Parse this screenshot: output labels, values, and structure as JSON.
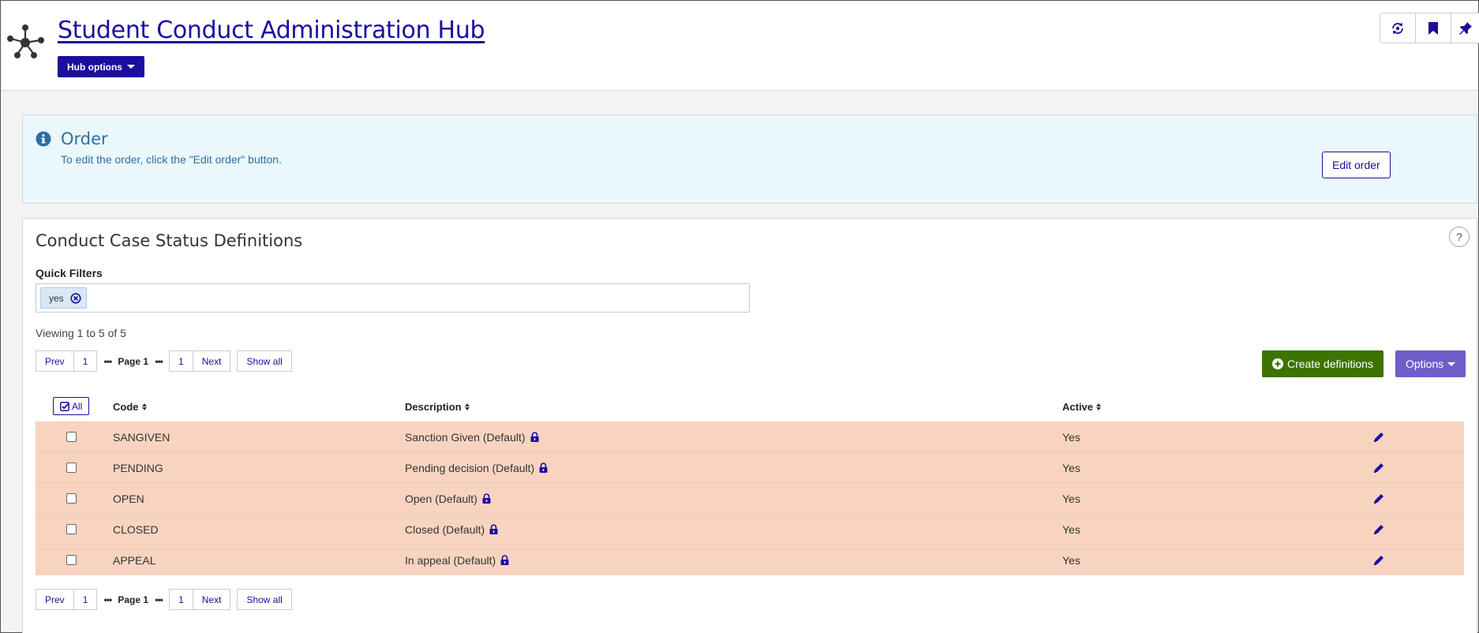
{
  "header": {
    "title": "Student Conduct Administration Hub",
    "hub_options_label": "Hub options",
    "tools": [
      "sync-icon",
      "bookmark-icon",
      "pin-icon"
    ]
  },
  "order_panel": {
    "title": "Order",
    "text": "To edit the order, click the \"Edit order\" button.",
    "edit_button": "Edit order"
  },
  "definitions": {
    "title": "Conduct Case Status Definitions",
    "help_label": "?",
    "quick_filters": {
      "label": "Quick Filters",
      "chips": [
        "yes"
      ]
    },
    "viewing_text": "Viewing 1 to 5 of 5",
    "pager": {
      "prev": "Prev",
      "first": "1",
      "dots": "•••",
      "current": "Page 1",
      "last": "1",
      "next": "Next",
      "show_all": "Show all"
    },
    "create_button": "Create definitions",
    "options_button": "Options",
    "table": {
      "select_all_label": "All",
      "columns": [
        "Code",
        "Description",
        "Active"
      ],
      "rows": [
        {
          "code": "SANGIVEN",
          "description": "Sanction Given (Default)",
          "active": "Yes"
        },
        {
          "code": "PENDING",
          "description": "Pending decision (Default)",
          "active": "Yes"
        },
        {
          "code": "OPEN",
          "description": "Open (Default)",
          "active": "Yes"
        },
        {
          "code": "CLOSED",
          "description": "Closed (Default)",
          "active": "Yes"
        },
        {
          "code": "APPEAL",
          "description": "In appeal (Default)",
          "active": "Yes"
        }
      ]
    }
  },
  "colors": {
    "brand": "#1c0d9e",
    "create_green": "#3d7300",
    "options_purple": "#6e5ec9",
    "row_highlight": "#f8d4c0",
    "info_bg": "#eaf7fb",
    "info_text": "#2d6fa5"
  }
}
